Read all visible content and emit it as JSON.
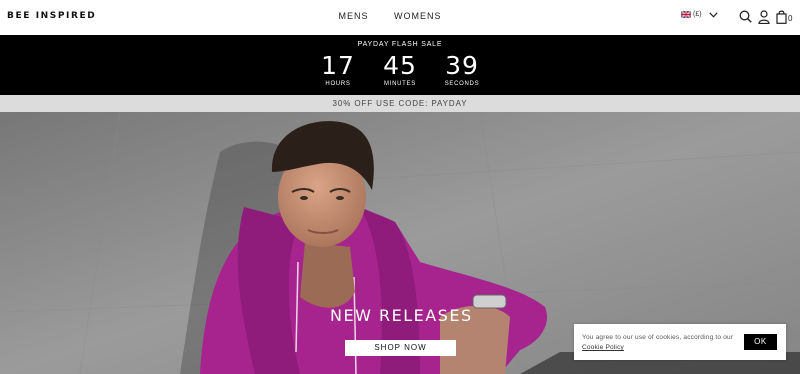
{
  "header": {
    "logo": "BEE INSPIRED",
    "nav": [
      {
        "label": "MENS"
      },
      {
        "label": "WOMENS"
      }
    ],
    "currency": "(£)",
    "bag_count": "0",
    "icons": [
      "uk-flag-icon",
      "chevron-down-icon",
      "search-icon",
      "account-icon",
      "bag-icon"
    ]
  },
  "sale": {
    "title": "PAYDAY FLASH SALE",
    "hours": "17",
    "hours_label": "HOURS",
    "minutes": "45",
    "minutes_label": "MINUTES",
    "seconds": "39",
    "seconds_label": "SECONDS"
  },
  "promo": {
    "text": "30% OFF USE CODE: PAYDAY"
  },
  "hero": {
    "title": "NEW RELEASES",
    "button": "SHOP NOW"
  },
  "cookie": {
    "text": "You agree to our use of cookies, according to our",
    "link": "Cookie Policy",
    "ok": "OK"
  },
  "colors": {
    "bar": "#000000",
    "promo_bg": "#dcdcdc",
    "hoodie": "#a7248f"
  }
}
